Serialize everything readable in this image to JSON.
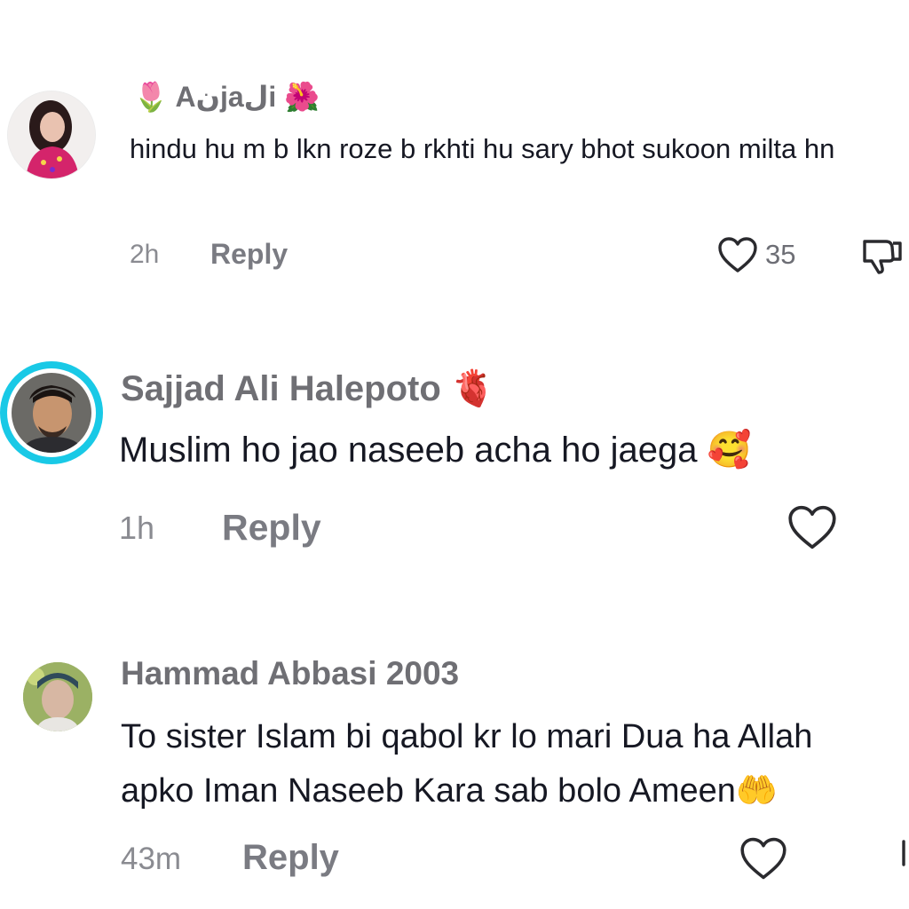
{
  "comments": [
    {
      "username": "Aنjaلi",
      "username_emoji_left": "🌷",
      "username_emoji_right": "🌺",
      "text": "hindu hu m b lkn roze b rkhti hu sary bhot sukoon milta hn",
      "time": "2h",
      "reply_label": "Reply",
      "like_count": "35",
      "avatar_icon": "profile-photo"
    },
    {
      "username": "Sajjad Ali Halepoto",
      "username_emoji_right": "🫀",
      "text": "Muslim ho jao naseeb acha ho jaega",
      "text_emoji": "🥰",
      "time": "1h",
      "reply_label": "Reply",
      "avatar_icon": "profile-photo"
    },
    {
      "username": "Hammad Abbasi 2003",
      "text": "To sister Islam bi qabol kr lo mari Dua ha Allah apko Iman Naseeb Kara sab bolo Ameen",
      "text_emoji": "🤲",
      "time": "43m",
      "reply_label": "Reply",
      "avatar_icon": "profile-photo"
    }
  ],
  "colors": {
    "story_ring": "#19c9e6",
    "muted_text": "#7a7b82",
    "body_text": "#161823"
  }
}
